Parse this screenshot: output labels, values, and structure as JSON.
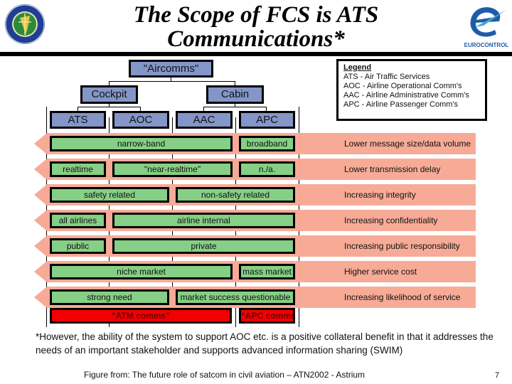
{
  "slide": {
    "title_line1": "The Scope of FCS is ATS",
    "title_line2": "Communications*",
    "page_number": "7"
  },
  "logos": {
    "left": {
      "name": "faa-logo",
      "ring_text_top": "FEDERAL AVIATION",
      "ring_text_bottom": "ADMINISTRATION"
    },
    "right": {
      "name": "eurocontrol-logo",
      "text": "EUROCONTROL"
    }
  },
  "tree": {
    "root": "\"Aircomms\"",
    "branches": [
      "Cockpit",
      "Cabin"
    ],
    "leaves": [
      "ATS",
      "AOC",
      "AAC",
      "APC"
    ]
  },
  "legend": {
    "title": "Legend",
    "items": [
      "ATS - Air Traffic Services",
      "AOC - Airline Operational Comm's",
      "AAC - Airline Administrative Comm's",
      "APC - Airline Passenger Comm's"
    ]
  },
  "rows": [
    {
      "boxes": [
        {
          "label": "narrow-band",
          "span": "ATS-AAC"
        },
        {
          "label": "broadband",
          "span": "APC"
        }
      ],
      "trend": "Lower message size/data volume"
    },
    {
      "boxes": [
        {
          "label": "realtime",
          "span": "ATS"
        },
        {
          "label": "\"near-realtime\"",
          "span": "AOC-AAC"
        },
        {
          "label": "n./a.",
          "span": "APC"
        }
      ],
      "trend": "Lower transmission delay"
    },
    {
      "boxes": [
        {
          "label": "safety related",
          "span": "ATS-AOC"
        },
        {
          "label": "non-safety related",
          "span": "AAC-APC"
        }
      ],
      "trend": "Increasing integrity"
    },
    {
      "boxes": [
        {
          "label": "all airlines",
          "span": "ATS"
        },
        {
          "label": "airline internal",
          "span": "AOC-APC"
        }
      ],
      "trend": "Increasing confidentiality"
    },
    {
      "boxes": [
        {
          "label": "public",
          "span": "ATS"
        },
        {
          "label": "private",
          "span": "AOC-APC"
        }
      ],
      "trend": "Increasing public responsibility"
    },
    {
      "boxes": [
        {
          "label": "niche market",
          "span": "ATS-AAC"
        },
        {
          "label": "mass market",
          "span": "APC"
        }
      ],
      "trend": "Higher service cost"
    },
    {
      "boxes": [
        {
          "label": "strong need",
          "span": "ATS-AOC"
        },
        {
          "label": "market success questionable",
          "span": "AAC-APC"
        }
      ],
      "trend": "Increasing likelihood of service"
    }
  ],
  "conclusion": {
    "atm": "“ATM comms”",
    "apc": "“APC comms”"
  },
  "colors": {
    "tree_box": "#8496c8",
    "category_box": "#86cf86",
    "band": "#f7ab97",
    "conclusion_box": "#f20000"
  },
  "footnote": "*However,  the ability of the system to support AOC etc. is a positive collateral benefit in that it addresses the needs of an important stakeholder and supports advanced information sharing (SWIM)",
  "source": "Figure from: The future role of satcom in civil aviation – ATN2002 - Astrium"
}
